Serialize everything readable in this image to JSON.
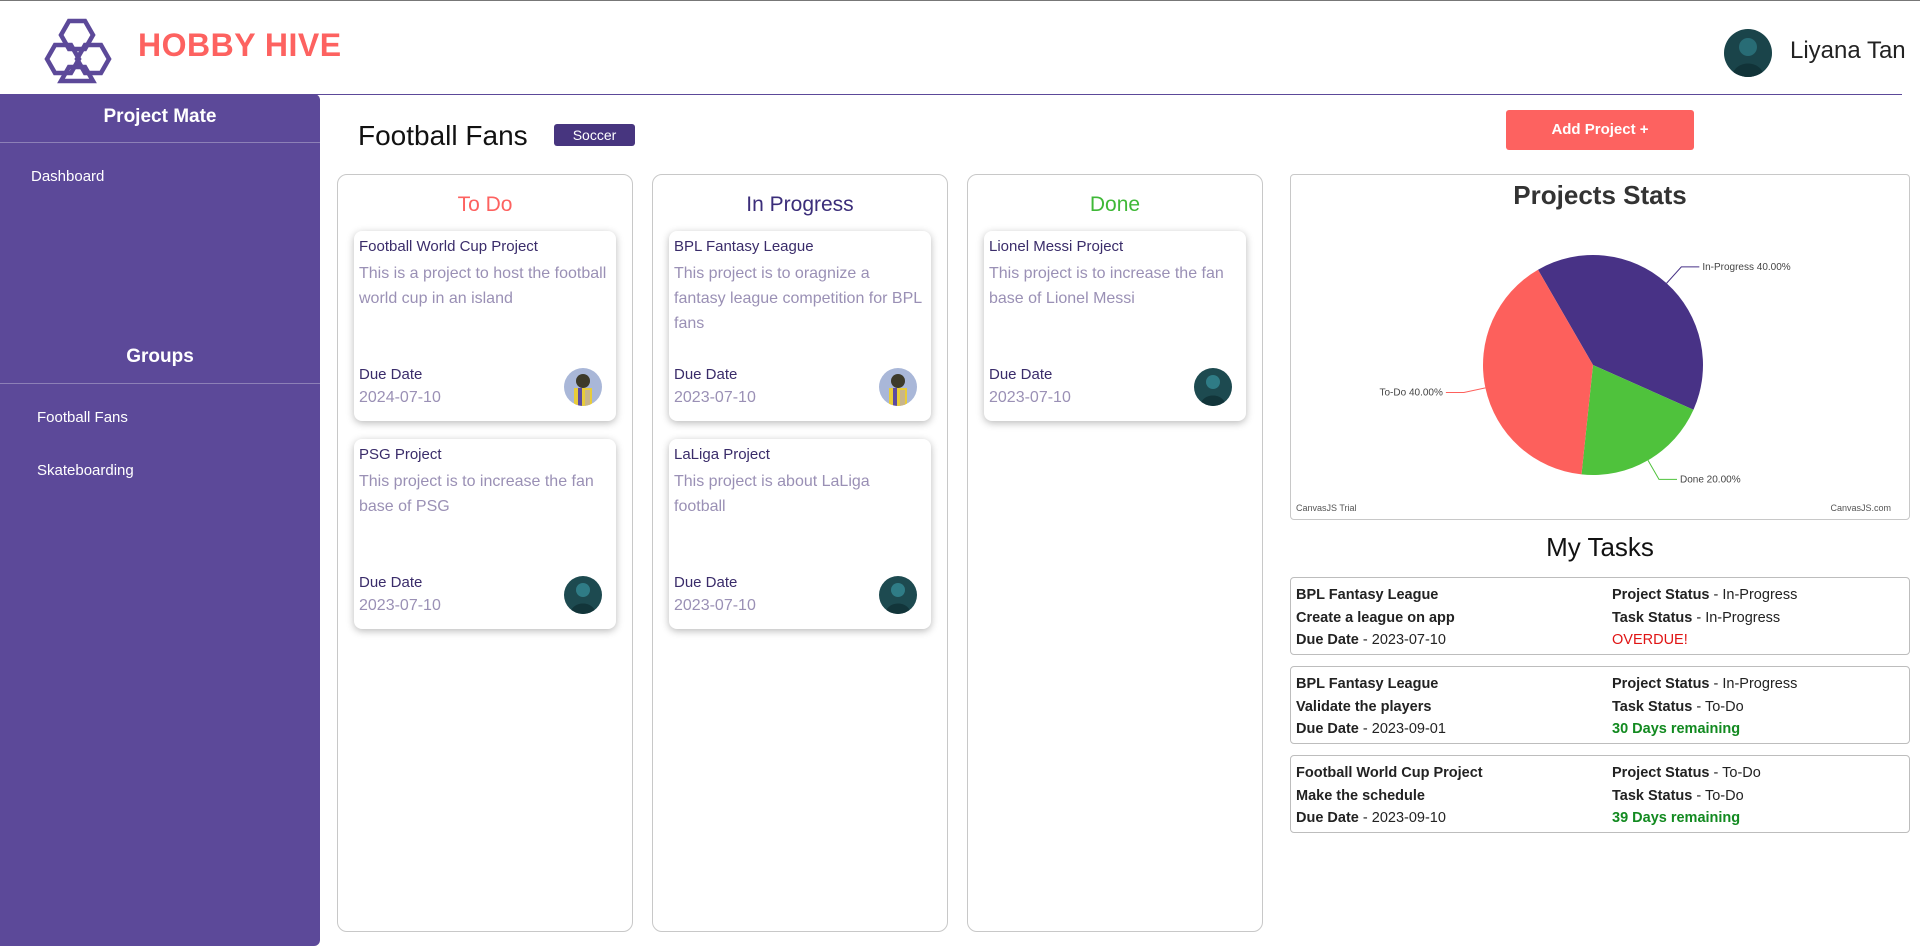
{
  "app": {
    "brand": "HOBBY HIVE",
    "user_name": "Liyana Tan"
  },
  "sidebar": {
    "section1_title": "Project Mate",
    "items": [
      {
        "label": "Dashboard"
      }
    ],
    "section2_title": "Groups",
    "groups": [
      {
        "label": "Football Fans"
      },
      {
        "label": "Skateboarding"
      }
    ]
  },
  "main": {
    "title": "Football Fans",
    "tag": "Soccer",
    "add_button": "Add Project +",
    "due_label": "Due Date",
    "columns": [
      {
        "title": "To Do",
        "color": "#fd6260",
        "cards": [
          {
            "title": "Football World Cup Project",
            "desc": "This is a project to host the football world cup in an island",
            "due": "2024-07-10",
            "avatar": "avatar-cartoon"
          },
          {
            "title": "PSG Project",
            "desc": "This project is to increase the fan base of PSG",
            "due": "2023-07-10",
            "avatar": "avatar-portrait"
          }
        ]
      },
      {
        "title": "In Progress",
        "color": "#3b2d7a",
        "cards": [
          {
            "title": "BPL Fantasy League",
            "desc": "This project is to oragnize a fantasy league competition for BPL fans",
            "due": "2023-07-10",
            "avatar": "avatar-cartoon"
          },
          {
            "title": "LaLiga Project",
            "desc": "This project is about LaLiga football",
            "due": "2023-07-10",
            "avatar": "avatar-portrait"
          }
        ]
      },
      {
        "title": "Done",
        "color": "#3fb837",
        "cards": [
          {
            "title": "Lionel Messi Project",
            "desc": "This project is to increase the fan base of Lionel Messi",
            "due": "2023-07-10",
            "avatar": "avatar-portrait"
          }
        ]
      }
    ]
  },
  "stats": {
    "title": "Projects Stats",
    "trial_left": "CanvasJS Trial",
    "trial_right": "CanvasJS.com",
    "chart_data": {
      "type": "pie",
      "title": "Projects Stats",
      "slices": [
        {
          "label": "In-Progress 40.00%",
          "name": "In-Progress",
          "value": 40,
          "color": "#483286"
        },
        {
          "label": "Done 20.00%",
          "name": "Done",
          "value": 20,
          "color": "#4fc23c"
        },
        {
          "label": "To-Do 40.00%",
          "name": "To-Do",
          "value": 40,
          "color": "#fd605c"
        }
      ]
    }
  },
  "tasks": {
    "title": "My Tasks",
    "ps_label": "Project Status",
    "ts_label": "Task Status",
    "due_label": "Due Date",
    "items": [
      {
        "project": "BPL Fantasy League",
        "task": "Create a league on app",
        "due": "2023-07-10",
        "project_status": "In-Progress",
        "task_status": "In-Progress",
        "remaining": "OVERDUE!",
        "remaining_state": "overdue"
      },
      {
        "project": "BPL Fantasy League",
        "task": "Validate the players",
        "due": "2023-09-01",
        "project_status": "In-Progress",
        "task_status": "To-Do",
        "remaining": "30 Days remaining",
        "remaining_state": "ok"
      },
      {
        "project": "Football World Cup Project",
        "task": "Make the schedule",
        "due": "2023-09-10",
        "project_status": "To-Do",
        "task_status": "To-Do",
        "remaining": "39 Days remaining",
        "remaining_state": "ok"
      }
    ]
  }
}
